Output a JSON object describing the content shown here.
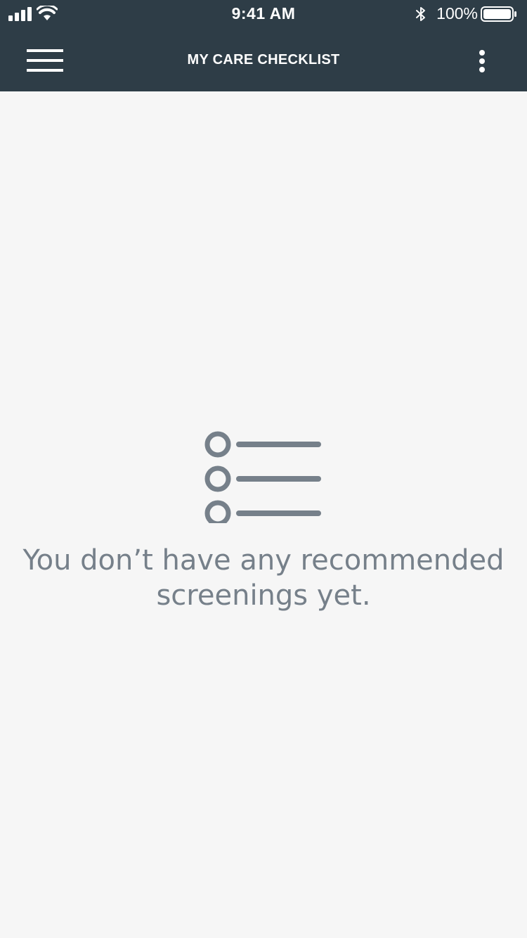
{
  "status_bar": {
    "time": "9:41 AM",
    "battery_percent": "100%",
    "icons": [
      "cellular-signal-icon",
      "wifi-icon",
      "bluetooth-icon",
      "battery-icon"
    ]
  },
  "header": {
    "title": "MY CARE CHECKLIST",
    "menu_icon": "hamburger-menu-icon",
    "more_icon": "more-vertical-icon",
    "background": "#2e3d47",
    "text_color": "#ffffff"
  },
  "empty_state": {
    "icon": "checklist-icon",
    "message": "You don’t have any recommended screenings yet.",
    "color": "#76808a"
  },
  "page_background": "#f6f6f6"
}
